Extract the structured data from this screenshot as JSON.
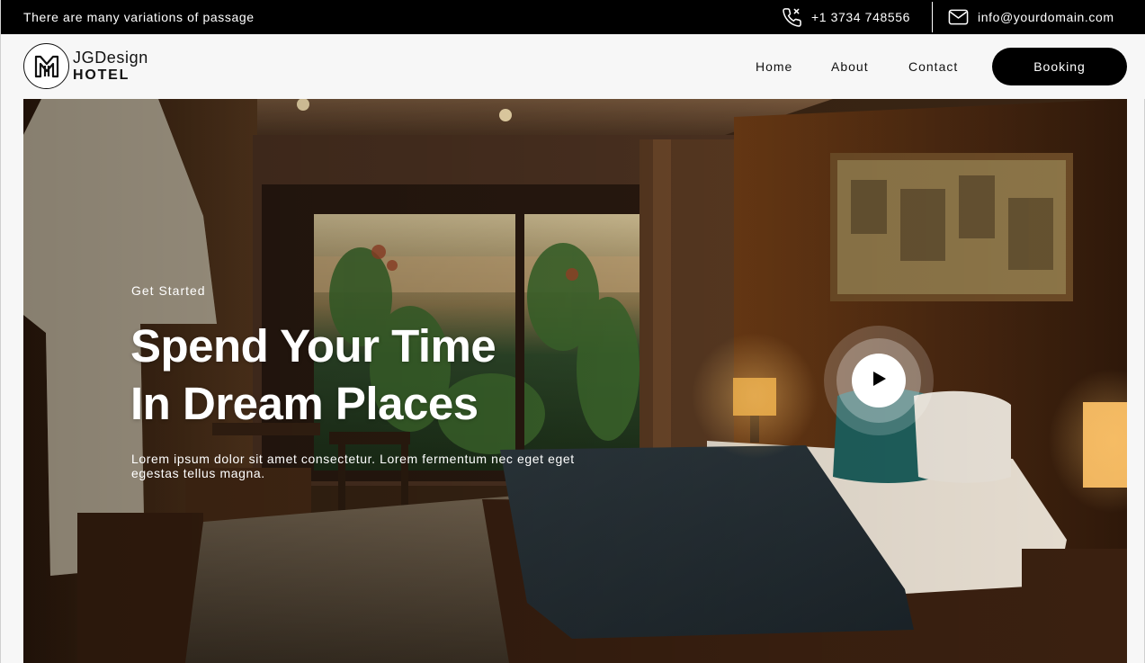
{
  "topbar": {
    "tagline": "There are many variations of passage",
    "phone": "+1 3734 748556",
    "phone_icon": "phone-icon",
    "email": "info@yourdomain.com",
    "email_icon": "mail-icon"
  },
  "header": {
    "logo": {
      "line1": "JGDesign",
      "line2": "HOTEL",
      "mark_icon": "hm-monogram-icon"
    },
    "nav": [
      {
        "label": "Home"
      },
      {
        "label": "About"
      },
      {
        "label": "Contact"
      }
    ],
    "booking_label": "Booking"
  },
  "hero": {
    "eyebrow": "Get Started",
    "title_line1": "Spend Your Time",
    "title_line2": "In Dream Places",
    "description": "Lorem ipsum dolor sit amet consectetur. Lorem fermentum nec eget eget egestas tellus magna.",
    "play_icon": "play-icon",
    "image": "hotel-bedroom-photo"
  },
  "colors": {
    "topbar_bg": "#000000",
    "header_bg": "#f7f7f7",
    "button_bg": "#000000",
    "text_light": "#ffffff"
  }
}
